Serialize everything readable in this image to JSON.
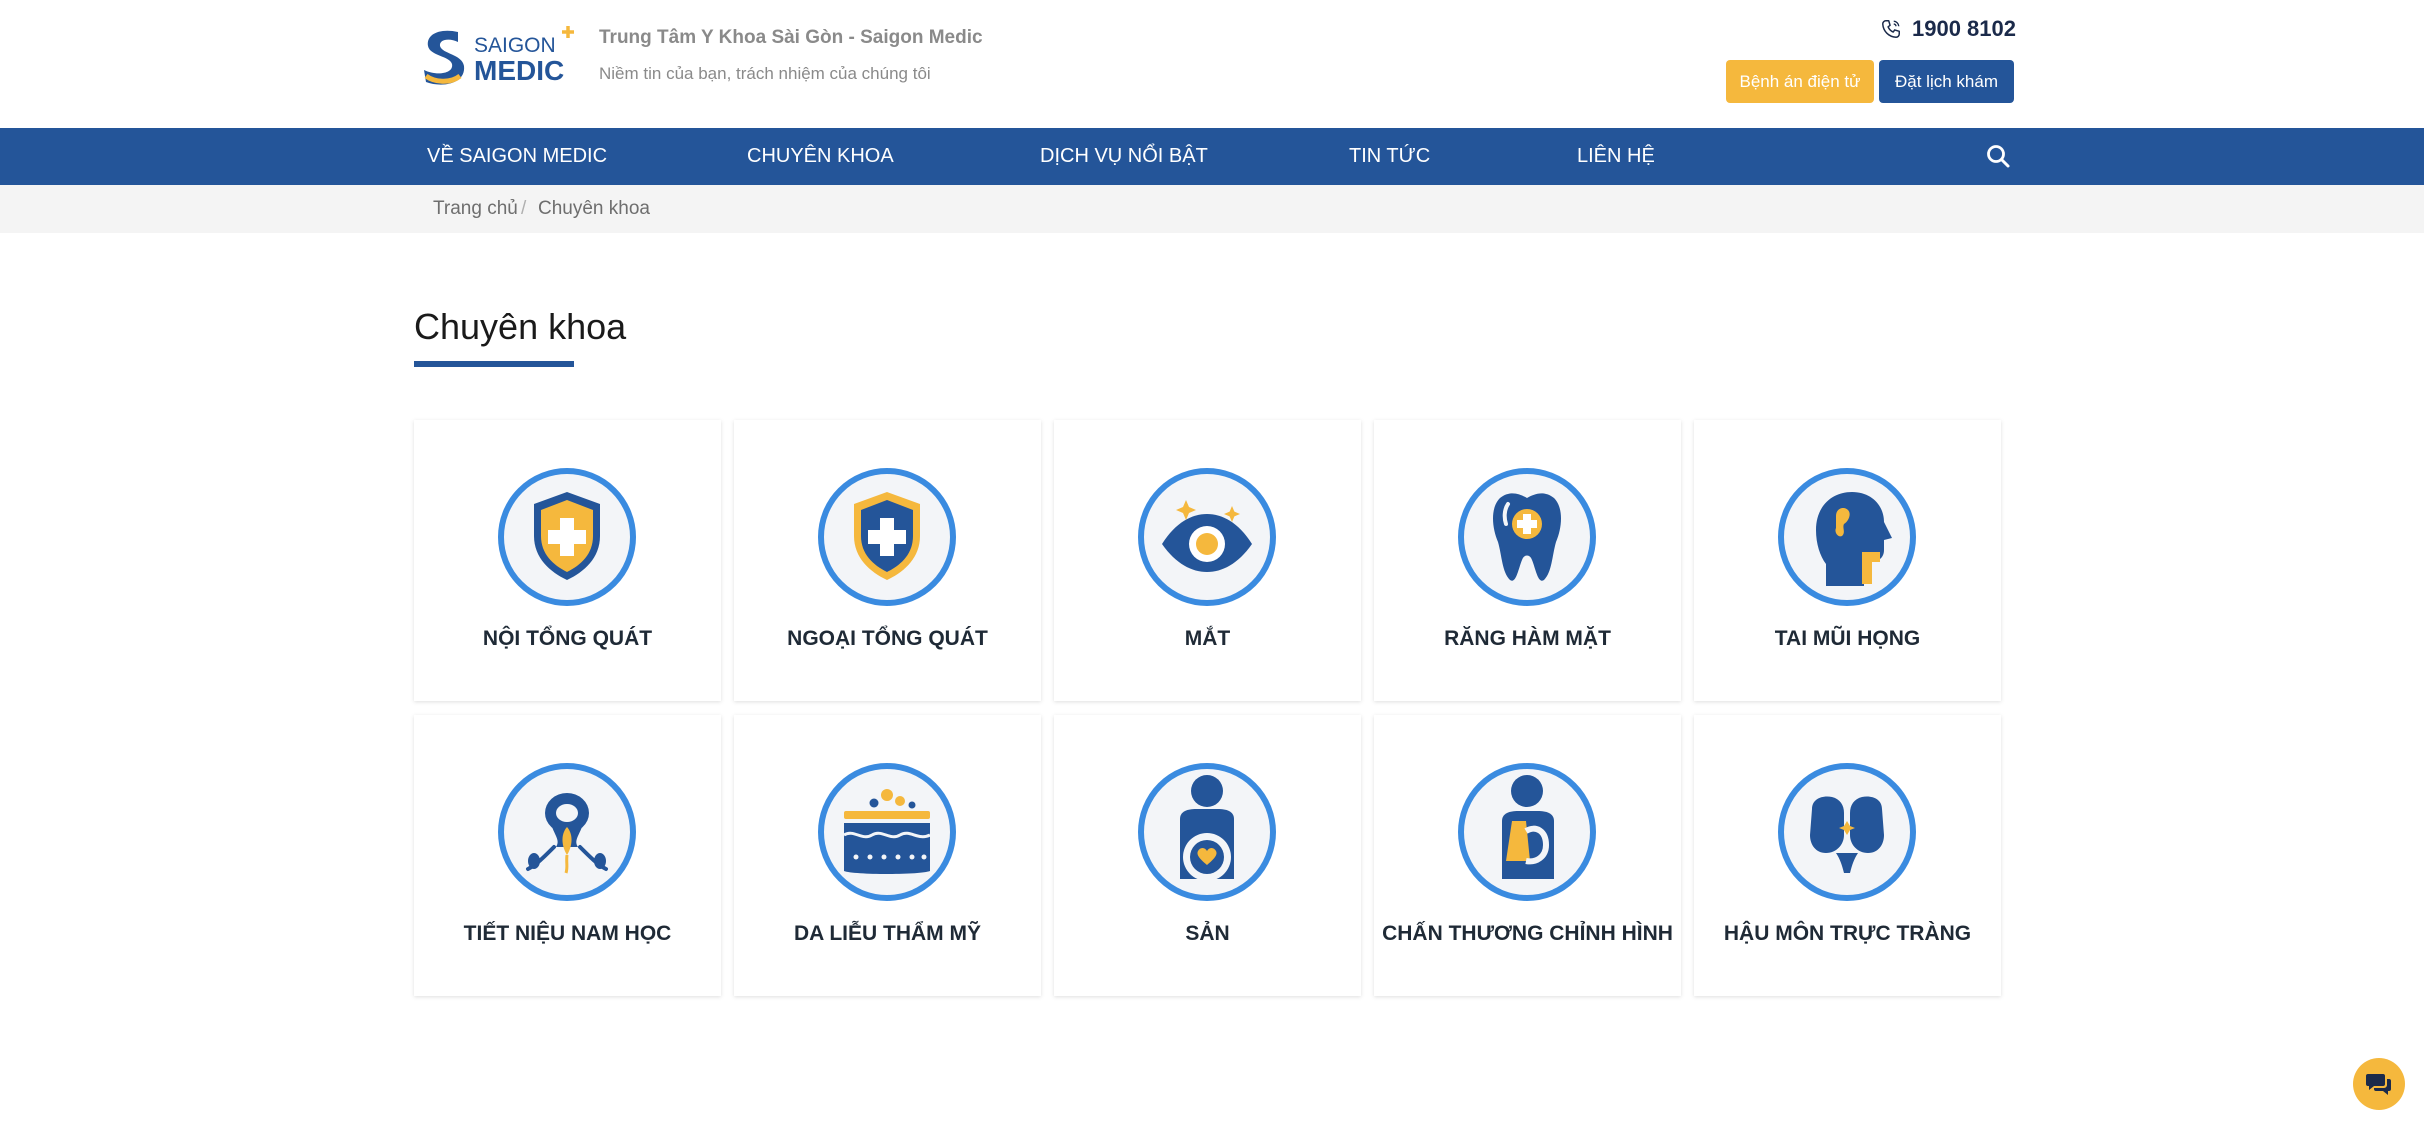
{
  "colors": {
    "brand_blue": "#245599",
    "brand_yellow": "#f5b83d",
    "icon_ring": "#3a8be0"
  },
  "header": {
    "logo_alt": "SAIGON MEDIC",
    "title": "Trung Tâm Y Khoa Sài Gòn - Saigon Medic",
    "subtitle": "Niềm tin của bạn, trách nhiệm của chúng tôi",
    "hotline": "1900 8102",
    "hotline_icon": "phone-icon",
    "emr_button": "Bệnh án điện tử",
    "booking_button": "Đặt lịch khám"
  },
  "nav": {
    "items": [
      "VỀ SAIGON MEDIC",
      "CHUYÊN KHOA",
      "DỊCH VỤ NỔI BẬT",
      "TIN TỨC",
      "LIÊN HỆ"
    ],
    "search_icon": "search-icon"
  },
  "breadcrumb": {
    "home": "Trang chủ",
    "separator": "/",
    "current": "Chuyên khoa"
  },
  "page": {
    "title": "Chuyên khoa"
  },
  "specialties": [
    {
      "label": "NỘI TỔNG QUÁT",
      "icon": "shield-cross-yellow-icon"
    },
    {
      "label": "NGOẠI TỔNG QUÁT",
      "icon": "shield-cross-blue-icon"
    },
    {
      "label": "MẮT",
      "icon": "eye-icon"
    },
    {
      "label": "RĂNG HÀM MẶT",
      "icon": "tooth-icon"
    },
    {
      "label": "TAI MŨI HỌNG",
      "icon": "ear-nose-throat-icon"
    },
    {
      "label": "TIẾT NIỆU NAM HỌC",
      "icon": "urology-icon"
    },
    {
      "label": "DA LIỄU THẨM MỸ",
      "icon": "skin-layers-icon"
    },
    {
      "label": "SẢN",
      "icon": "pregnancy-icon"
    },
    {
      "label": "CHẤN THƯƠNG CHỈNH HÌNH",
      "icon": "orthopedic-icon"
    },
    {
      "label": "HẬU MÔN TRỰC TRÀNG",
      "icon": "colon-icon"
    }
  ],
  "chat": {
    "icon": "chat-icon"
  }
}
